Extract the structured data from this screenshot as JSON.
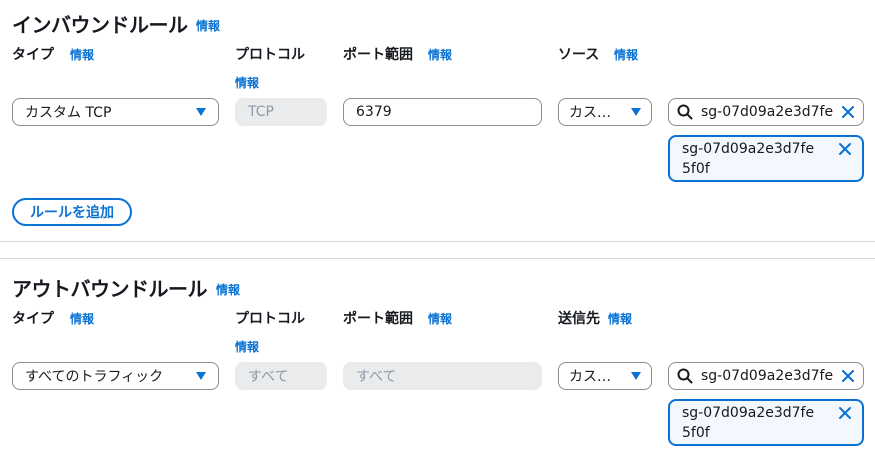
{
  "info_label": "情報",
  "inbound": {
    "title": "インバウンドルール",
    "headers": {
      "type": "タイプ",
      "protocol": "プロトコル",
      "port_range": "ポート範囲",
      "source": "ソース"
    },
    "rule": {
      "type_value": "カスタム TCP",
      "protocol_value": "TCP",
      "port_value": "6379",
      "source_value": "カス…",
      "search_value": "sg-07d09a2e3d7fe",
      "token_value": "sg-07d09a2e3d7fe5f0f"
    },
    "add_rule_label": "ルールを追加"
  },
  "outbound": {
    "title": "アウトバウンドルール",
    "headers": {
      "type": "タイプ",
      "protocol": "プロトコル",
      "port_range": "ポート範囲",
      "destination": "送信先"
    },
    "rule": {
      "type_value": "すべてのトラフィック",
      "protocol_value": "すべて",
      "port_value": "すべて",
      "destination_value": "カス…",
      "search_value": "sg-07d09a2e3d7fe",
      "token_value": "sg-07d09a2e3d7fe5f0f"
    }
  },
  "icons": {
    "caret": "caret-down-icon",
    "search": "search-icon",
    "close": "close-icon"
  },
  "colors": {
    "accent": "#0972d3",
    "text": "#16191f",
    "disabled_bg": "#e9ebed",
    "token_bg": "#f2f8fd"
  }
}
